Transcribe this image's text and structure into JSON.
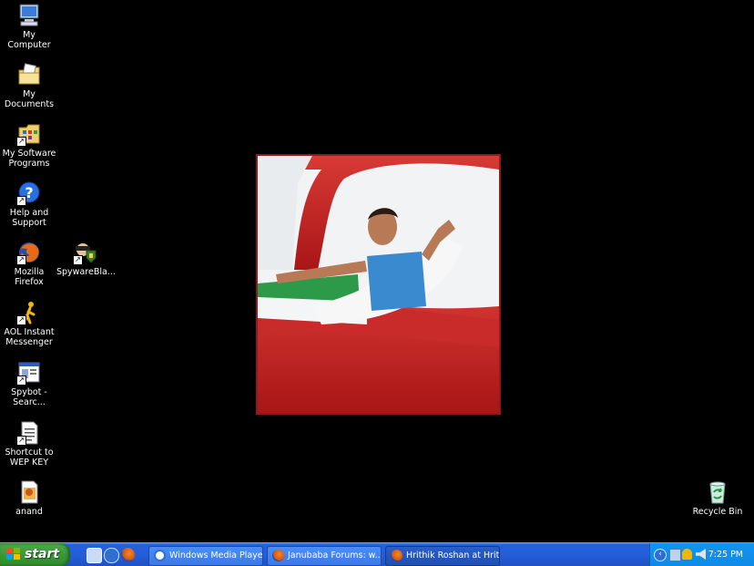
{
  "desktop": {
    "icons": [
      {
        "label": "My Computer",
        "icon": "my-computer-icon"
      },
      {
        "label": "My Documents",
        "icon": "my-documents-icon"
      },
      {
        "label": "My Software Programs",
        "icon": "software-programs-icon"
      },
      {
        "label": "Help and Support",
        "icon": "help-support-icon"
      },
      {
        "label": "Mozilla Firefox",
        "icon": "firefox-icon"
      },
      {
        "label": "SpywareBla...",
        "icon": "spywareblaster-icon"
      },
      {
        "label": "AOL Instant Messenger",
        "icon": "aim-icon"
      },
      {
        "label": "Spybot - Searc...",
        "icon": "spybot-icon"
      },
      {
        "label": "Shortcut to WEP KEY",
        "icon": "text-file-icon"
      },
      {
        "label": "anand",
        "icon": "image-file-icon"
      },
      {
        "label": "Recycle Bin",
        "icon": "recycle-bin-icon"
      }
    ],
    "wallpaper": {
      "icon": "wallpaper-photo"
    }
  },
  "taskbar": {
    "start_label": "start",
    "quick_launch": [
      {
        "icon": "show-desktop-icon"
      },
      {
        "icon": "media-player-icon"
      },
      {
        "icon": "firefox-icon"
      }
    ],
    "tasks": [
      {
        "label": "Windows Media Player",
        "icon": "media-player-icon"
      },
      {
        "label": "Janubaba Forums: w...",
        "icon": "firefox-icon"
      },
      {
        "label": "Hrithik Roshan at Hrit...",
        "icon": "firefox-icon"
      }
    ],
    "tray": {
      "clock": "7:25 PM",
      "icons": [
        "expand-tray-icon",
        "network-icon",
        "aim-tray-icon",
        "volume-icon"
      ]
    }
  },
  "colors": {
    "taskbar": "#245edb",
    "start": "#3d9a3a",
    "tray": "#0d8ae6",
    "desktop": "#000000"
  }
}
